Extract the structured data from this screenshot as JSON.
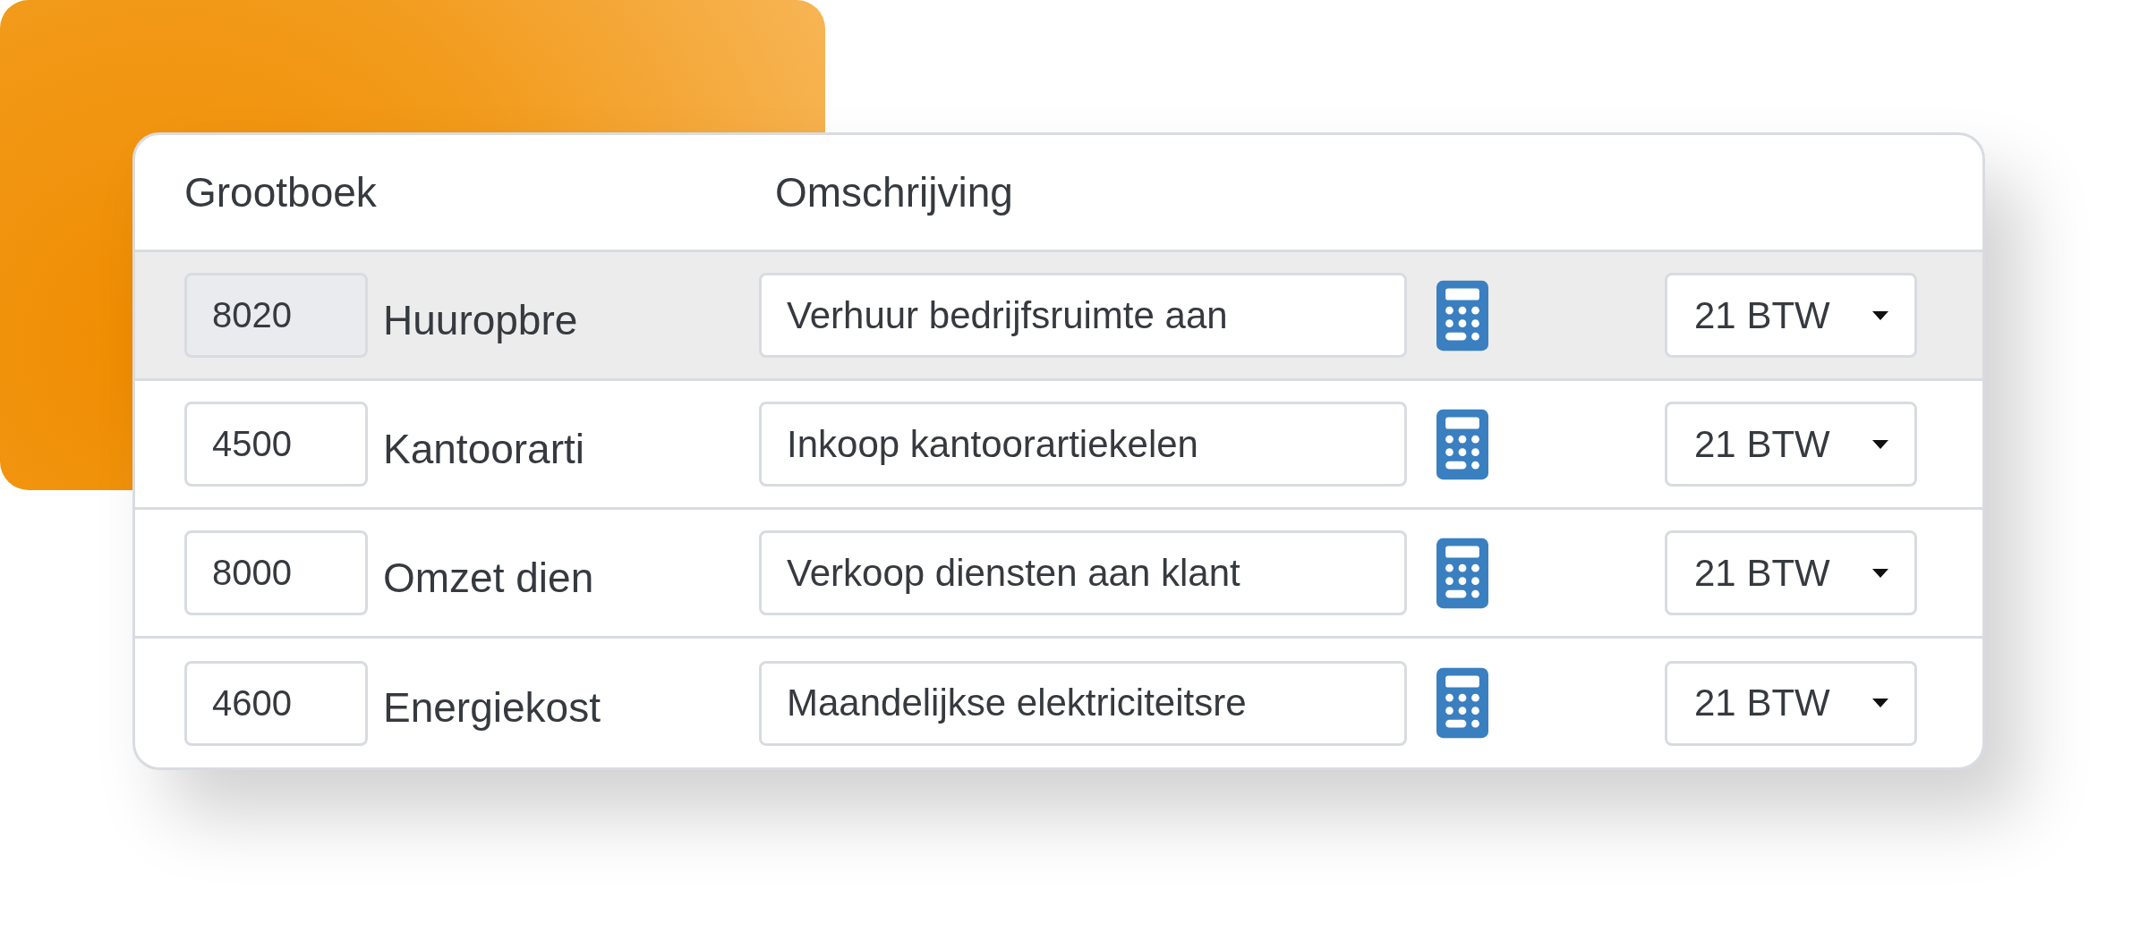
{
  "table": {
    "columns": [
      "Grootboek",
      "Omschrijving"
    ],
    "rows": [
      {
        "selected": true,
        "code": "8020",
        "name": "Huuropbre",
        "description": "Verhuur bedrijfsruimte aan",
        "vat": "21 BTW"
      },
      {
        "selected": false,
        "code": "4500",
        "name": "Kantoorarti",
        "description": "Inkoop kantoorartiekelen",
        "vat": "21 BTW"
      },
      {
        "selected": false,
        "code": "8000",
        "name": "Omzet dien",
        "description": "Verkoop diensten aan klant",
        "vat": "21 BTW"
      },
      {
        "selected": false,
        "code": "4600",
        "name": "Energiekost",
        "description": "Maandelijkse elektriciteitsre",
        "vat": "21 BTW"
      }
    ]
  }
}
